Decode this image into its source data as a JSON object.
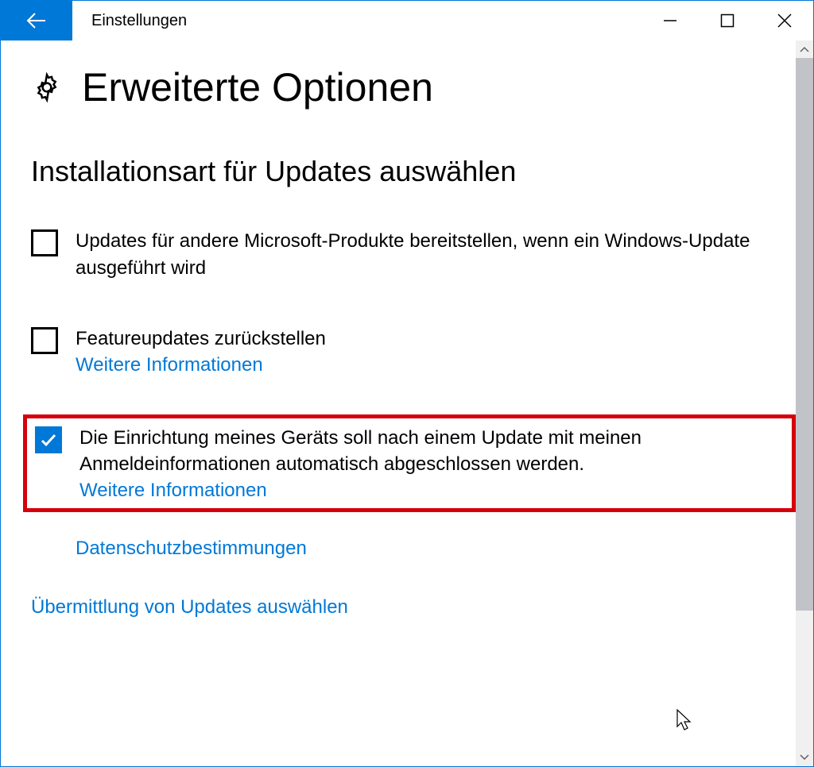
{
  "window": {
    "title": "Einstellungen"
  },
  "page": {
    "heading": "Erweiterte Optionen"
  },
  "section": {
    "heading": "Installationsart für Updates auswählen"
  },
  "options": {
    "opt1": {
      "label": "Updates für andere Microsoft-Produkte bereitstellen, wenn ein Windows-Update ausgeführt wird",
      "checked": false
    },
    "opt2": {
      "label": "Featureupdates zurückstellen",
      "more": "Weitere Informationen",
      "checked": false
    },
    "opt3": {
      "label": "Die Einrichtung meines Geräts soll nach einem Update mit meinen Anmeldeinformationen automatisch abgeschlossen werden.",
      "more": "Weitere Informationen",
      "checked": true
    }
  },
  "links": {
    "privacy": "Datenschutzbestimmungen",
    "delivery": "Übermittlung von Updates auswählen"
  }
}
